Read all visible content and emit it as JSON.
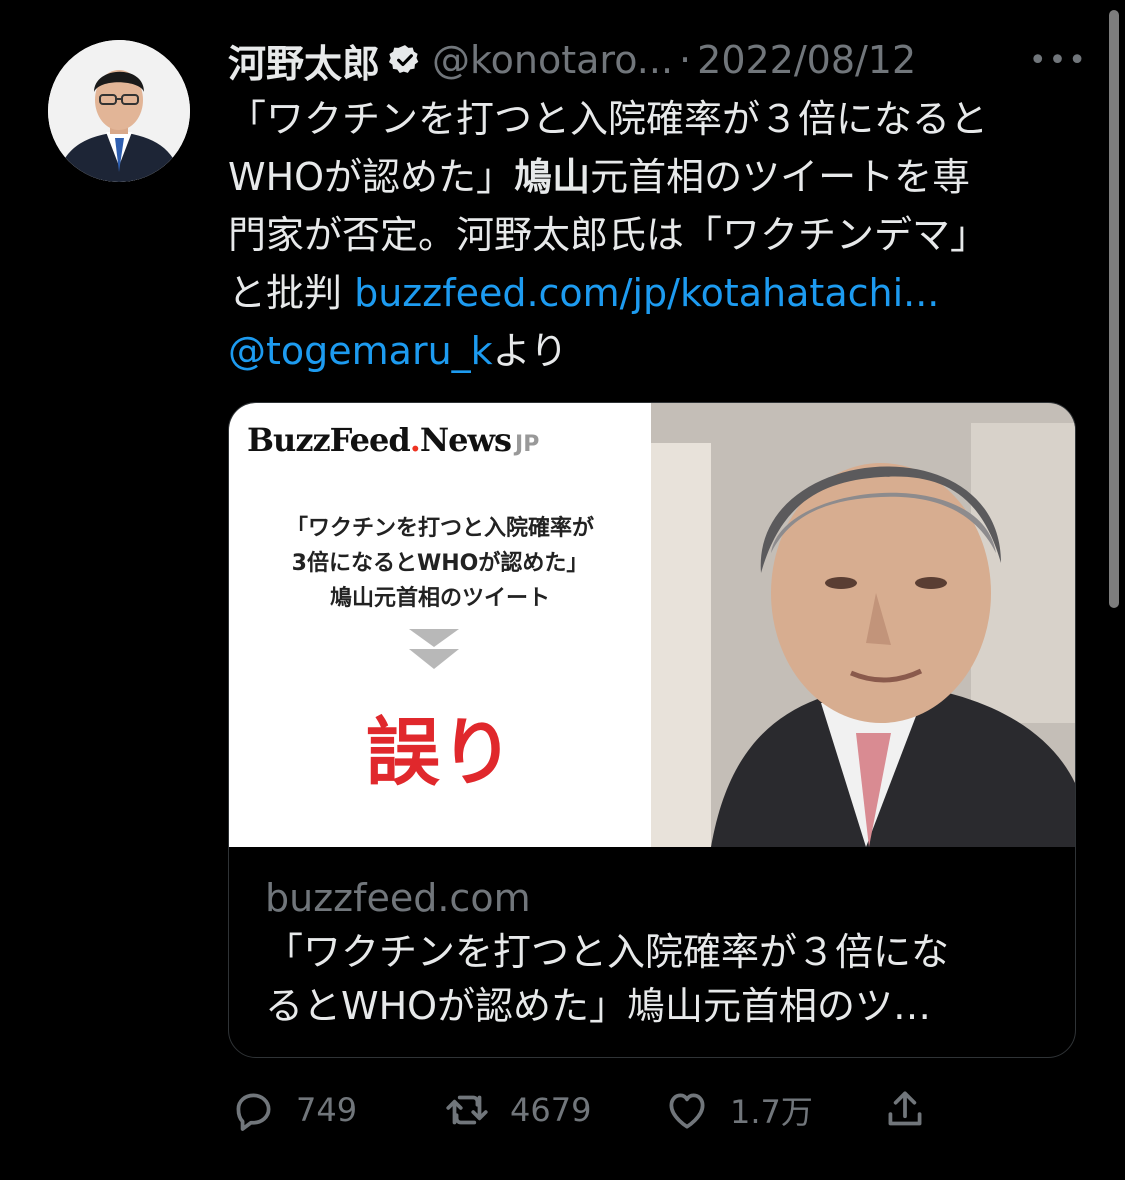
{
  "tweet": {
    "author_name": "河野太郎",
    "author_handle": "@konotaro...",
    "separator": "·",
    "date": "2022/08/12",
    "more_label": "•••",
    "text_lines": [
      "「ワクチンを打つと入院確率が３倍になると",
      "WHOが認めた」",
      "元首相のツイートを専",
      "門家が否定。河野太郎氏は「ワクチンデマ」",
      "と批判 ",
      "buzzfeed.com/jp/kotahatachi...",
      "@togemaru_k",
      "より"
    ],
    "bold_text": "鳩山"
  },
  "card": {
    "image": {
      "logo_word1": "BuzzFeed",
      "logo_dot": ".",
      "logo_word2": "News",
      "logo_suffix": "JP",
      "headline_lines": [
        "「ワクチンを打つと入院確率が",
        "3倍になるとWHOが認めた」",
        "鳩山元首相のツイート"
      ],
      "verdict": "誤り"
    },
    "domain": "buzzfeed.com",
    "title_lines": [
      "「ワクチンを打つと入院確率が３倍にな",
      "るとWHOが認めた」鳩山元首相のツ…"
    ]
  },
  "actions": {
    "replies": "749",
    "retweets": "4679",
    "likes": "1.7万"
  },
  "colors": {
    "background": "#000000",
    "text": "#e7e9ea",
    "muted": "#71767b",
    "link": "#1d9bf0",
    "verdict_red": "#e0282c"
  }
}
